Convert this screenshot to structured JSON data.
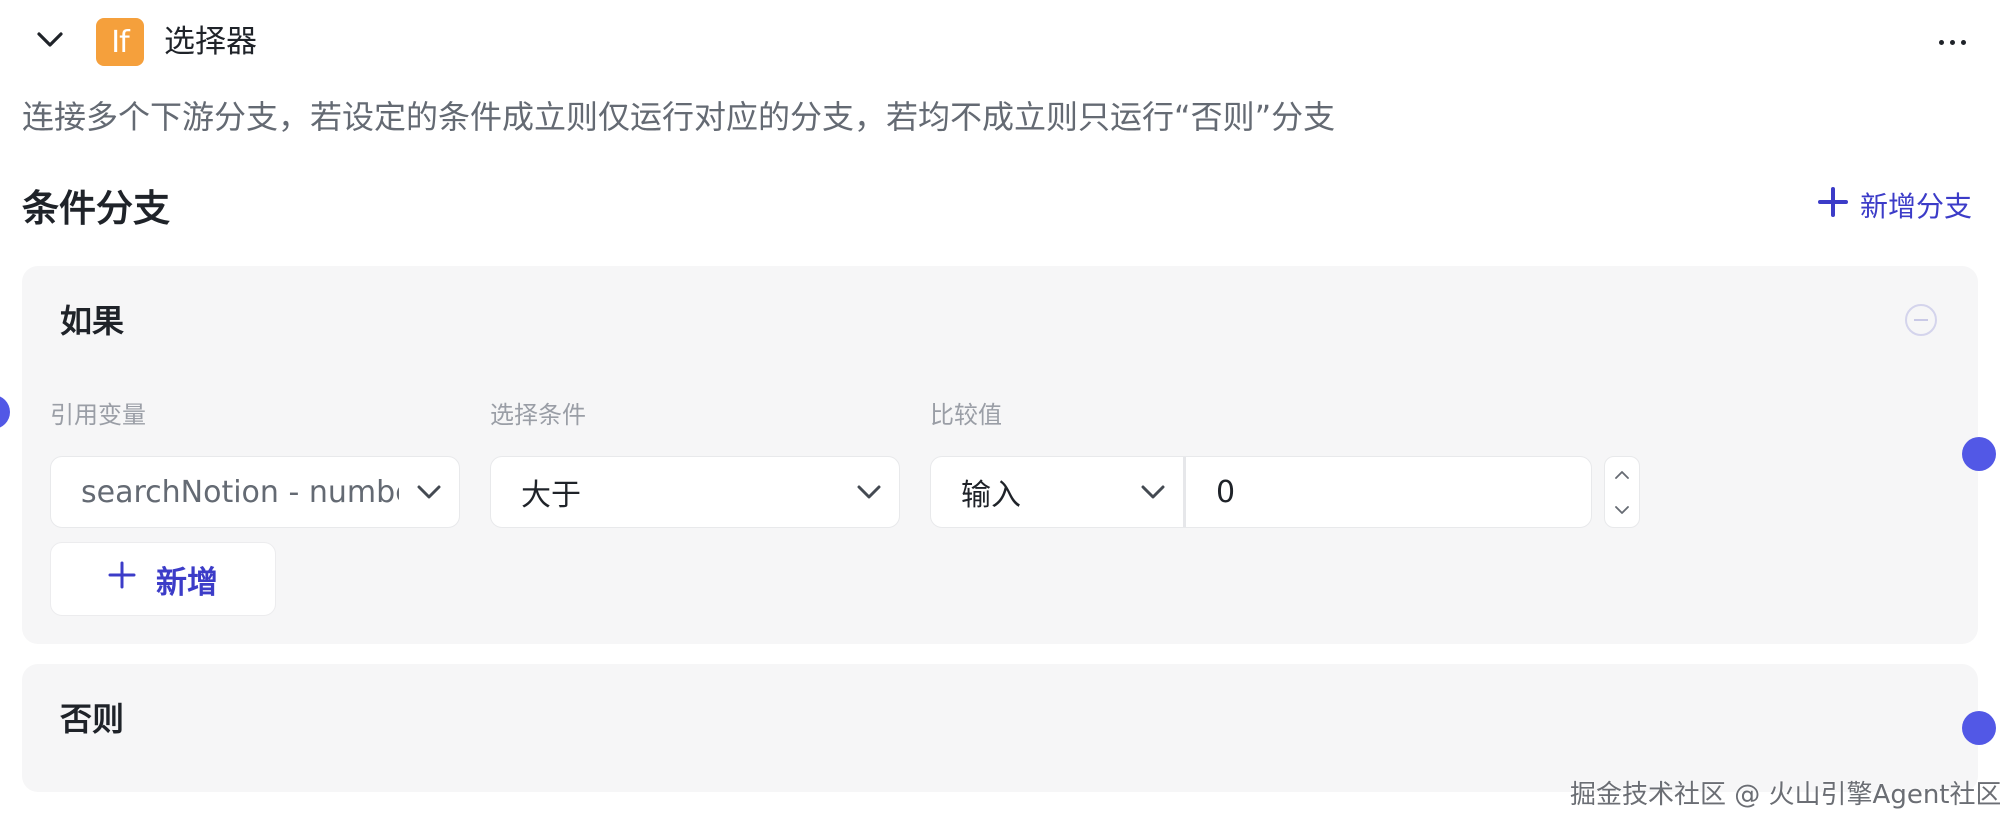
{
  "header": {
    "badge_text": "If",
    "title": "选择器",
    "description": "连接多个下游分支，若设定的条件成立则仅运行对应的分支，若均不成立则只运行“否则”分支"
  },
  "section": {
    "title": "条件分支",
    "add_branch_label": "新增分支"
  },
  "if_branch": {
    "label": "如果",
    "field_labels": {
      "variable": "引用变量",
      "condition": "选择条件",
      "compare": "比较值"
    },
    "variable_value": "searchNotion - number",
    "condition_value": "大于",
    "compare_type": "输入",
    "compare_value": "0",
    "add_condition_label": "新增"
  },
  "else_branch": {
    "label": "否则"
  },
  "watermark": "掘金技术社区 @ 火山引擎Agent社区",
  "colors": {
    "accent": "#3c3cc8",
    "port": "#5258e6",
    "badge": "#f5a03c",
    "card_bg": "#f6f6f7"
  },
  "icons": [
    "chevron-down-icon",
    "more-icon",
    "plus-icon",
    "minus-circle-icon",
    "chevron-up-icon"
  ]
}
